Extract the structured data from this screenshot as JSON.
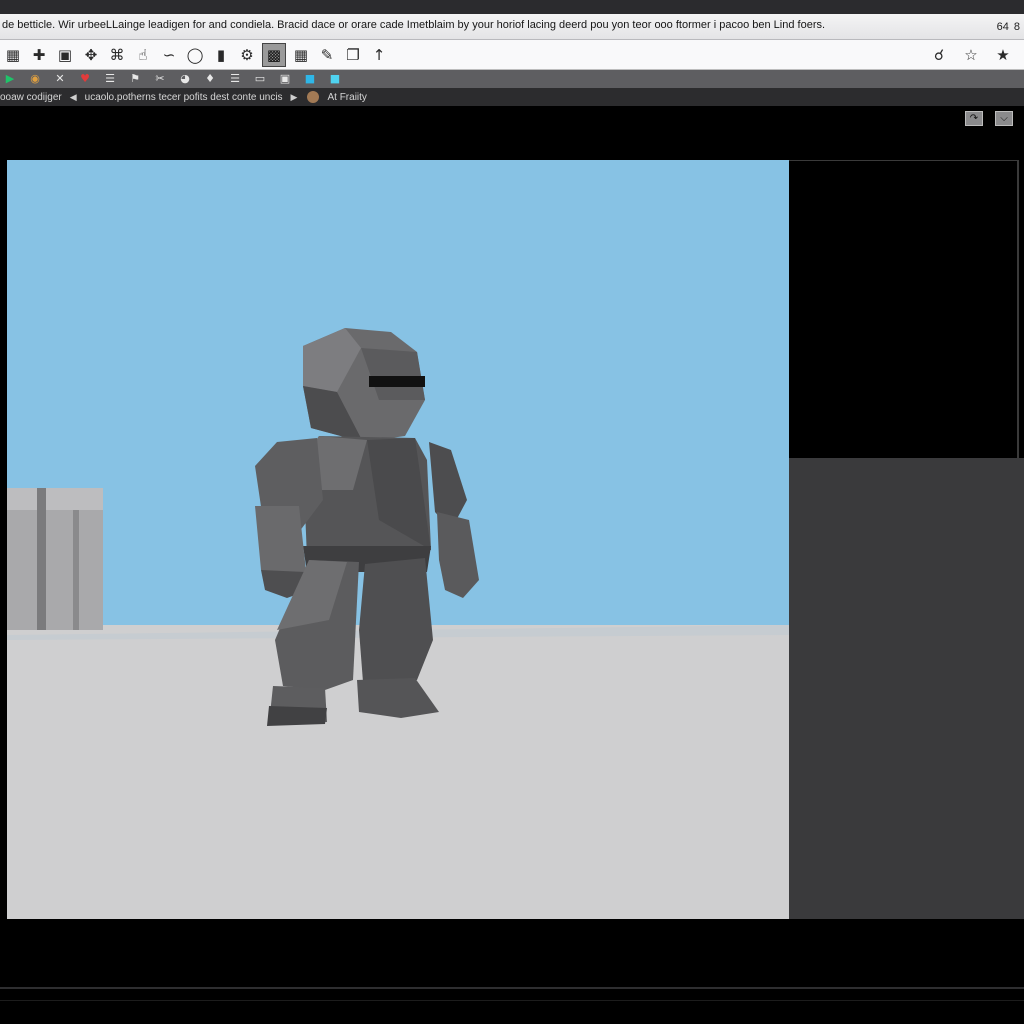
{
  "window": {
    "title": "de betticle. Wir urbeeLLainge leadigen for and condiela. Bracid dace or orare cade Imetblaim by your horiof lacing deerd pou yon teor ooo ftormer i pacoo ben Lind foers.",
    "right_glyphs": [
      "64",
      "8"
    ]
  },
  "toolbar": {
    "icons": [
      "grid-icon",
      "plus-icon",
      "screen-icon",
      "move-icon",
      "settings-icon",
      "hand-icon",
      "curve-icon",
      "cylinder-icon",
      "histogram-icon",
      "gear-icon",
      "monitor-icon",
      "mesh-icon",
      "paint-icon",
      "copy-icon",
      "pin-icon"
    ],
    "right_icons": [
      "pin-tool-icon",
      "star-icon",
      "star-outline-icon"
    ],
    "active_index": 10
  },
  "toolbar2": {
    "icons": [
      "green-play-icon",
      "globe-icon",
      "x-icon",
      "heart-icon",
      "text-icon",
      "flag-icon",
      "scissors-icon",
      "palette-icon",
      "keyframe-icon",
      "layers-icon",
      "box-icon",
      "cube-icon",
      "cyan-cube-icon",
      "aqua-cube-icon"
    ]
  },
  "breadcrumb": {
    "segment1": "ooaw codijger",
    "segment2": "ucaolo.potherns tecer pofits dest conte uncis",
    "segment3": "At Fraiity"
  },
  "viewport": {
    "sky_color": "#87c2e4",
    "ground_color": "#cfcfd0",
    "character_color": "#5a5a5c"
  },
  "colors": {
    "app_bg": "#000000",
    "toolbar_bg": "#f9f9fa",
    "panel_bg": "#3a3a3c"
  }
}
